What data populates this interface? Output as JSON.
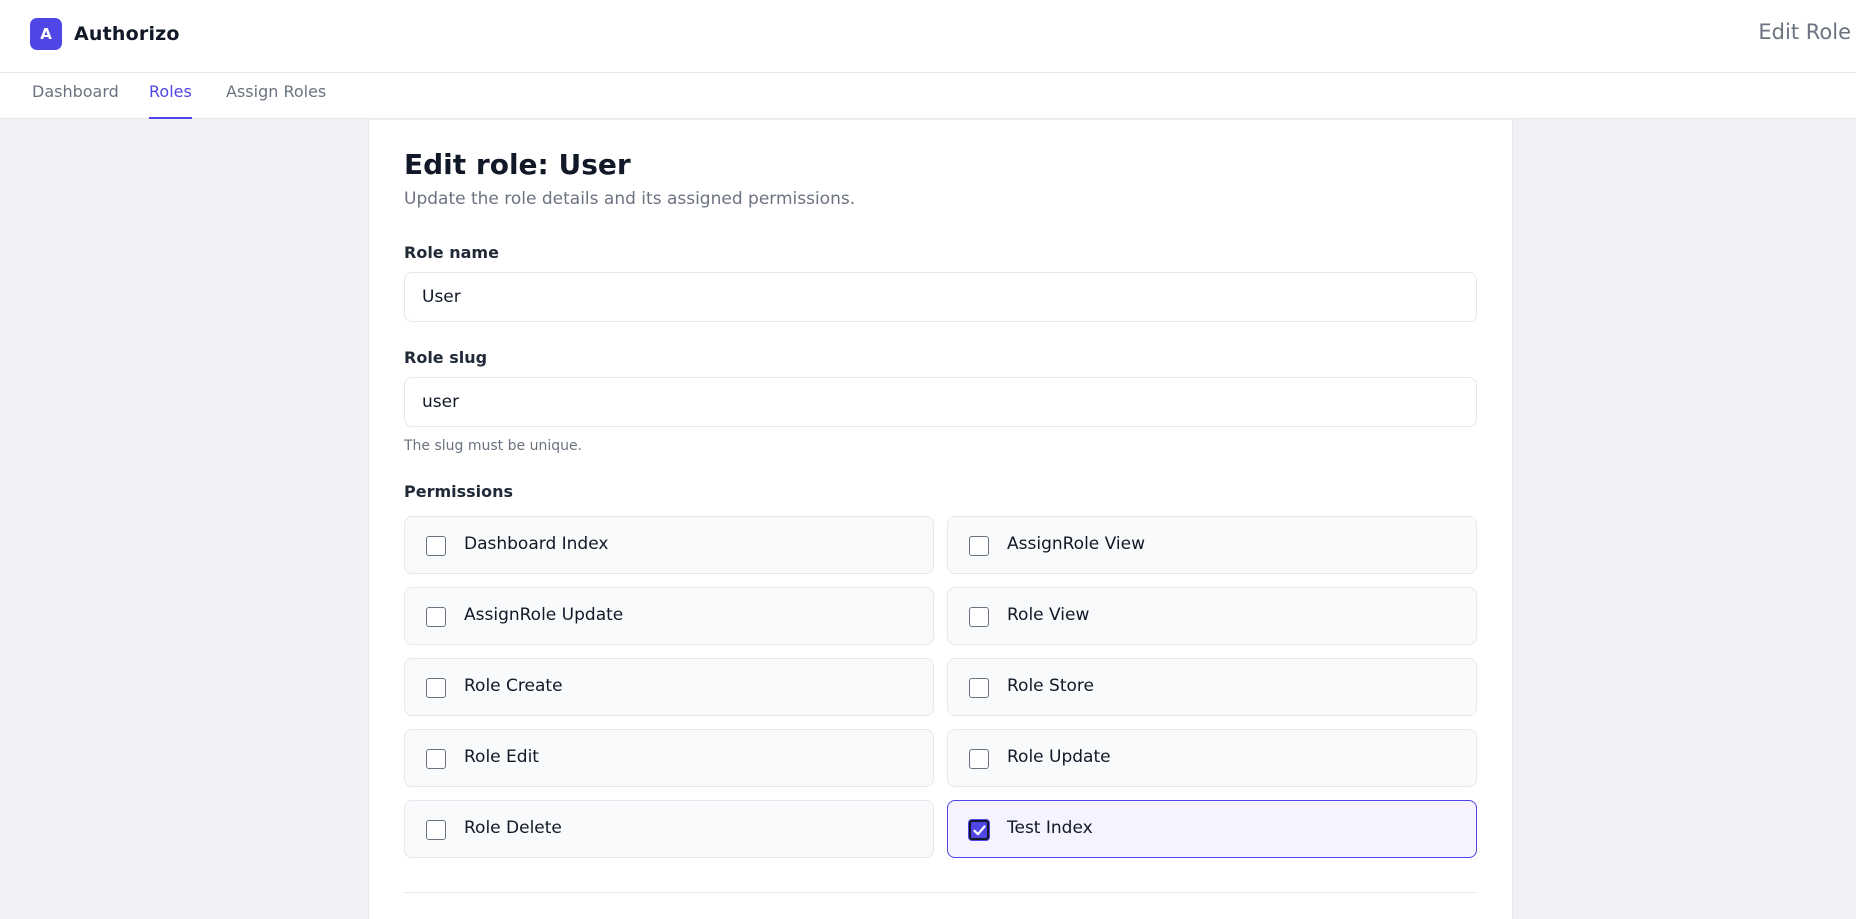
{
  "app": {
    "logo_letter": "A",
    "name": "Authorizo",
    "page_heading": "Edit Role"
  },
  "nav": {
    "items": [
      {
        "label": "Dashboard",
        "active": false
      },
      {
        "label": "Roles",
        "active": true
      },
      {
        "label": "Assign Roles",
        "active": false
      }
    ]
  },
  "form": {
    "title": "Edit role: User",
    "subtitle": "Update the role details and its assigned permissions.",
    "role_name": {
      "label": "Role name",
      "value": "User"
    },
    "role_slug": {
      "label": "Role slug",
      "value": "user",
      "hint": "The slug must be unique."
    },
    "permissions": {
      "label": "Permissions",
      "items": [
        {
          "label": "Dashboard Index",
          "checked": false
        },
        {
          "label": "AssignRole View",
          "checked": false
        },
        {
          "label": "AssignRole Update",
          "checked": false
        },
        {
          "label": "Role View",
          "checked": false
        },
        {
          "label": "Role Create",
          "checked": false
        },
        {
          "label": "Role Store",
          "checked": false
        },
        {
          "label": "Role Edit",
          "checked": false
        },
        {
          "label": "Role Update",
          "checked": false
        },
        {
          "label": "Role Delete",
          "checked": false
        },
        {
          "label": "Test Index",
          "checked": true
        }
      ]
    }
  },
  "colors": {
    "accent": "#4f46e5",
    "background": "#f1f2f6",
    "muted_text": "#6b7280"
  }
}
